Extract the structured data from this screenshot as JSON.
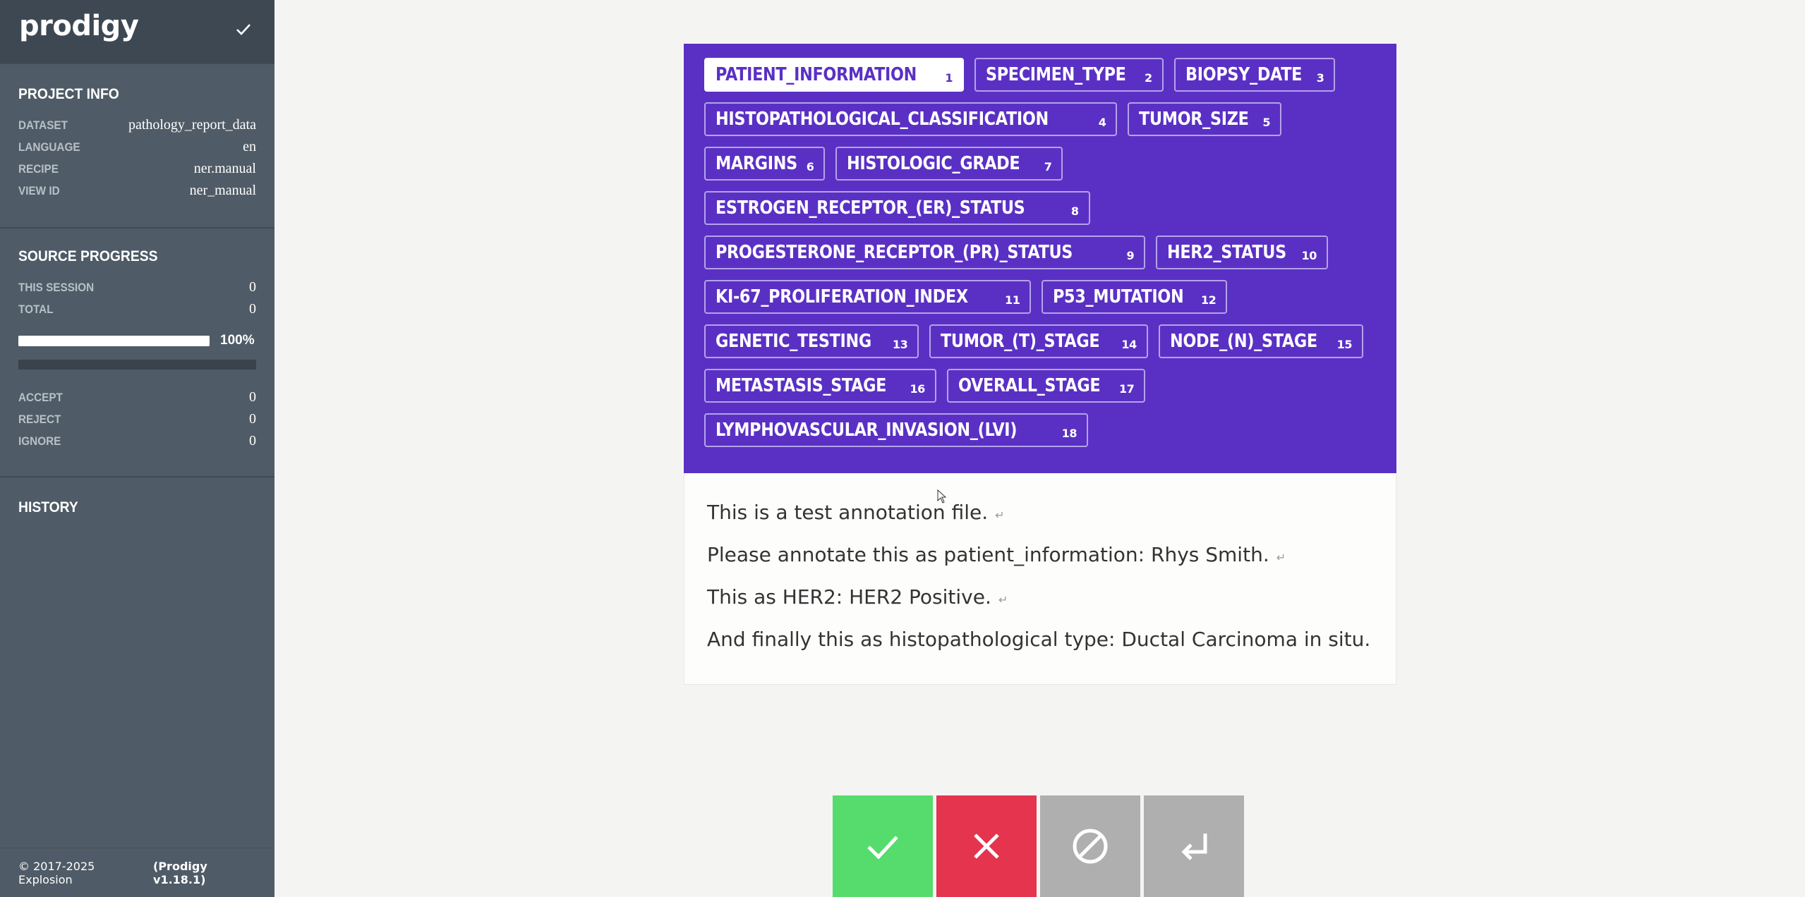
{
  "app": {
    "logo": "prodigy"
  },
  "project_info": {
    "title": "PROJECT INFO",
    "rows": [
      {
        "key": "DATASET",
        "value": "pathology_report_data"
      },
      {
        "key": "LANGUAGE",
        "value": "en"
      },
      {
        "key": "RECIPE",
        "value": "ner.manual"
      },
      {
        "key": "VIEW ID",
        "value": "ner_manual"
      }
    ]
  },
  "source_progress": {
    "title": "SOURCE PROGRESS",
    "rows": [
      {
        "key": "THIS SESSION",
        "value": "0"
      },
      {
        "key": "TOTAL",
        "value": "0"
      }
    ],
    "progress_percent": 100,
    "progress_label": "100%",
    "counts": [
      {
        "key": "ACCEPT",
        "value": "0"
      },
      {
        "key": "REJECT",
        "value": "0"
      },
      {
        "key": "IGNORE",
        "value": "0"
      }
    ]
  },
  "history": {
    "title": "HISTORY"
  },
  "footer": {
    "copyright": "© 2017-2025 Explosion",
    "version": "(Prodigy v1.18.1)"
  },
  "labels": [
    {
      "name": "PATIENT_INFORMATION",
      "key": "1",
      "selected": true
    },
    {
      "name": "SPECIMEN_TYPE",
      "key": "2"
    },
    {
      "name": "BIOPSY_DATE",
      "key": "3"
    },
    {
      "name": "HISTOPATHOLOGICAL_CLASSIFICATION",
      "key": "4"
    },
    {
      "name": "TUMOR_SIZE",
      "key": "5"
    },
    {
      "name": "MARGINS",
      "key": "6"
    },
    {
      "name": "HISTOLOGIC_GRADE",
      "key": "7"
    },
    {
      "name": "ESTROGEN_RECEPTOR_(ER)_STATUS",
      "key": "8"
    },
    {
      "name": "PROGESTERONE_RECEPTOR_(PR)_STATUS",
      "key": "9"
    },
    {
      "name": "HER2_STATUS",
      "key": "10"
    },
    {
      "name": "KI-67_PROLIFERATION_INDEX",
      "key": "11"
    },
    {
      "name": "P53_MUTATION",
      "key": "12"
    },
    {
      "name": "GENETIC_TESTING",
      "key": "13"
    },
    {
      "name": "TUMOR_(T)_STAGE",
      "key": "14"
    },
    {
      "name": "NODE_(N)_STAGE",
      "key": "15"
    },
    {
      "name": "METASTASIS_STAGE",
      "key": "16"
    },
    {
      "name": "OVERALL_STAGE",
      "key": "17"
    },
    {
      "name": "LYMPHOVASCULAR_INVASION_(LVI)",
      "key": "18"
    }
  ],
  "text_lines": [
    {
      "text": "This is a test annotation file.",
      "newline": "↵"
    },
    {
      "text": "Please annotate this as patient_information: Rhys Smith.",
      "newline": "↵"
    },
    {
      "text": "This as HER2: HER2 Positive.",
      "newline": "↵"
    },
    {
      "text": "And finally this as histopathological type: Ductal Carcinoma in situ.",
      "newline": ""
    }
  ],
  "colors": {
    "accept": "#55dc6c",
    "reject": "#e5344e",
    "ignore": "#afafaf",
    "label_panel": "#5a30c4",
    "sidebar": "#4f5b66"
  },
  "actions": [
    {
      "name": "accept",
      "icon": "check-icon"
    },
    {
      "name": "reject",
      "icon": "close-icon"
    },
    {
      "name": "ignore",
      "icon": "ignore-icon"
    },
    {
      "name": "undo",
      "icon": "undo-icon"
    }
  ]
}
